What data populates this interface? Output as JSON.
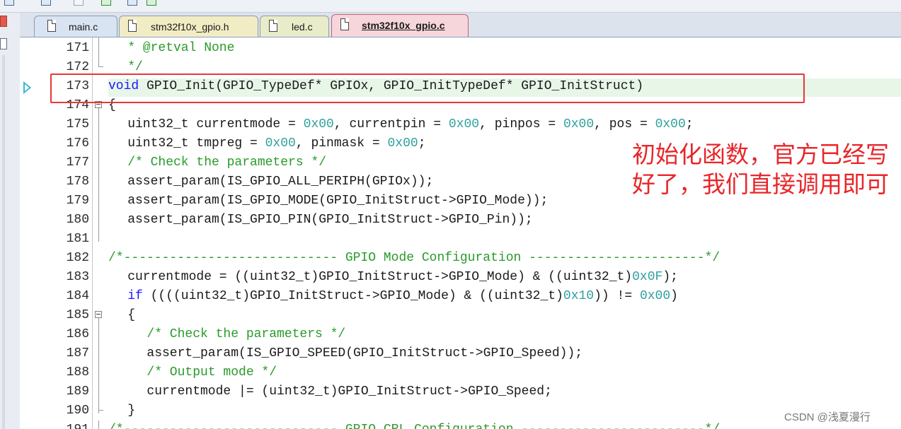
{
  "tabs": [
    {
      "label": "main.c",
      "active": false
    },
    {
      "label": "stm32f10x_gpio.h",
      "active": false
    },
    {
      "label": "led.c",
      "active": false
    },
    {
      "label": "stm32f10x_gpio.c",
      "active": true
    }
  ],
  "lines": [
    {
      "n": "171",
      "segs": [
        [
          "cmt",
          "* @retval None"
        ]
      ],
      "indent": 2
    },
    {
      "n": "172",
      "segs": [
        [
          "cmt",
          "*/"
        ]
      ],
      "indent": 2
    },
    {
      "n": "173",
      "segs": [
        [
          "kw",
          "void"
        ],
        [
          "",
          " GPIO_Init(GPIO_TypeDef* GPIOx, GPIO_InitTypeDef* GPIO_InitStruct)"
        ]
      ],
      "indent": 0
    },
    {
      "n": "174",
      "segs": [
        [
          "",
          "{"
        ]
      ],
      "indent": 0
    },
    {
      "n": "175",
      "segs": [
        [
          "",
          "uint32_t currentmode = "
        ],
        [
          "num",
          "0x00"
        ],
        [
          "",
          ", currentpin = "
        ],
        [
          "num",
          "0x00"
        ],
        [
          "",
          ", pinpos = "
        ],
        [
          "num",
          "0x00"
        ],
        [
          "",
          ", pos = "
        ],
        [
          "num",
          "0x00"
        ],
        [
          "",
          ";"
        ]
      ],
      "indent": 2
    },
    {
      "n": "176",
      "segs": [
        [
          "",
          "uint32_t tmpreg = "
        ],
        [
          "num",
          "0x00"
        ],
        [
          "",
          ", pinmask = "
        ],
        [
          "num",
          "0x00"
        ],
        [
          "",
          ";"
        ]
      ],
      "indent": 2
    },
    {
      "n": "177",
      "segs": [
        [
          "cmt",
          "/* Check the parameters */"
        ]
      ],
      "indent": 2
    },
    {
      "n": "178",
      "segs": [
        [
          "",
          "assert_param(IS_GPIO_ALL_PERIPH(GPIOx));"
        ]
      ],
      "indent": 2
    },
    {
      "n": "179",
      "segs": [
        [
          "",
          "assert_param(IS_GPIO_MODE(GPIO_InitStruct->GPIO_Mode));"
        ]
      ],
      "indent": 2
    },
    {
      "n": "180",
      "segs": [
        [
          "",
          "assert_param(IS_GPIO_PIN(GPIO_InitStruct->GPIO_Pin));"
        ]
      ],
      "indent": 2
    },
    {
      "n": "181",
      "segs": [],
      "indent": 0
    },
    {
      "n": "182",
      "segs": [
        [
          "cmt",
          "/*---------------------------- GPIO Mode Configuration -----------------------*/"
        ]
      ],
      "indent": 0
    },
    {
      "n": "183",
      "segs": [
        [
          "",
          "currentmode = ((uint32_t)GPIO_InitStruct->GPIO_Mode) & ((uint32_t)"
        ],
        [
          "num",
          "0x0F"
        ],
        [
          "",
          ");"
        ]
      ],
      "indent": 2
    },
    {
      "n": "184",
      "segs": [
        [
          "kw",
          "if"
        ],
        [
          "",
          " ((((uint32_t)GPIO_InitStruct->GPIO_Mode) & ((uint32_t)"
        ],
        [
          "num",
          "0x10"
        ],
        [
          "",
          ")) != "
        ],
        [
          "num",
          "0x00"
        ],
        [
          "",
          ")"
        ]
      ],
      "indent": 2
    },
    {
      "n": "185",
      "segs": [
        [
          "",
          "{"
        ]
      ],
      "indent": 2
    },
    {
      "n": "186",
      "segs": [
        [
          "cmt",
          "/* Check the parameters */"
        ]
      ],
      "indent": 4
    },
    {
      "n": "187",
      "segs": [
        [
          "",
          "assert_param(IS_GPIO_SPEED(GPIO_InitStruct->GPIO_Speed));"
        ]
      ],
      "indent": 4
    },
    {
      "n": "188",
      "segs": [
        [
          "cmt",
          "/* Output mode */"
        ]
      ],
      "indent": 4
    },
    {
      "n": "189",
      "segs": [
        [
          "",
          "currentmode |= (uint32_t)GPIO_InitStruct->GPIO_Speed;"
        ]
      ],
      "indent": 4
    },
    {
      "n": "190",
      "segs": [
        [
          "",
          "}"
        ]
      ],
      "indent": 2
    },
    {
      "n": "191",
      "segs": [
        [
          "cmt",
          "/*---------------------------- GPIO CRL Configuration ------------------------*/"
        ]
      ],
      "indent": 0
    }
  ],
  "annotation": {
    "text": "初始化函数，官方已经写好了，我们直接调用即可"
  },
  "watermark": {
    "text": "CSDN @浅夏漫行"
  },
  "colors": {
    "keyword": "#1a1aff",
    "number": "#2fa09e",
    "comment": "#2a9b2a",
    "annotation": "#e8262a",
    "execution_arrow": "#38b7d6"
  }
}
